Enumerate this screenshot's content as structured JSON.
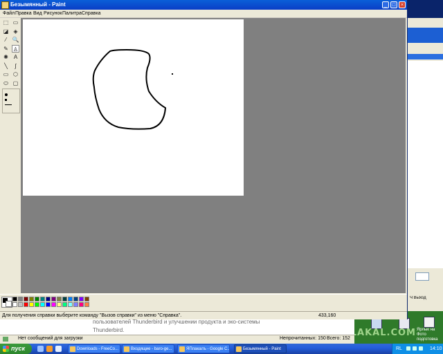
{
  "window": {
    "title": "Безымянный - Paint",
    "menu": [
      "Файл",
      "Правка",
      "Вид",
      "Рисунок",
      "Палитра",
      "Справка"
    ]
  },
  "toolbox": {
    "tools": [
      {
        "icon": "free-select-icon",
        "glyph": "⬚"
      },
      {
        "icon": "rect-select-icon",
        "glyph": "▭"
      },
      {
        "icon": "eraser-icon",
        "glyph": "◪"
      },
      {
        "icon": "fill-icon",
        "glyph": "◈"
      },
      {
        "icon": "color-picker-icon",
        "glyph": "⁄"
      },
      {
        "icon": "magnifier-icon",
        "glyph": "🔍"
      },
      {
        "icon": "pencil-icon",
        "glyph": "✎"
      },
      {
        "icon": "brush-icon",
        "glyph": "♙"
      },
      {
        "icon": "airbrush-icon",
        "glyph": "✺"
      },
      {
        "icon": "text-icon",
        "glyph": "A"
      },
      {
        "icon": "line-icon",
        "glyph": "╲"
      },
      {
        "icon": "curve-icon",
        "glyph": "∫"
      },
      {
        "icon": "rectangle-icon",
        "glyph": "▭"
      },
      {
        "icon": "polygon-icon",
        "glyph": "⬡"
      },
      {
        "icon": "ellipse-icon",
        "glyph": "⬭"
      },
      {
        "icon": "rounded-rect-icon",
        "glyph": "▢"
      }
    ],
    "selected_index": 7
  },
  "palette": {
    "foreground": "#000000",
    "background": "#ffffff",
    "colors_row1": [
      "#000000",
      "#808080",
      "#800000",
      "#808000",
      "#008000",
      "#008080",
      "#000080",
      "#800080",
      "#808040",
      "#004040",
      "#0080ff",
      "#004080",
      "#8000ff",
      "#804000"
    ],
    "colors_row2": [
      "#ffffff",
      "#c0c0c0",
      "#ff0000",
      "#ffff00",
      "#00ff00",
      "#00ffff",
      "#0000ff",
      "#ff00ff",
      "#ffff80",
      "#00ff80",
      "#80ffff",
      "#8080ff",
      "#ff0080",
      "#ff8040"
    ]
  },
  "status": {
    "help": "Для получения справки выберите команду \"Вызов справки\" из меню \"Справка\".",
    "coords": "433,160"
  },
  "browser": {
    "promo_line1": "пользователей Thunderbird и улучшении продукта и эко-системы",
    "promo_line2": "Thunderbird.",
    "status_text": "Нет сообщений для загрузки",
    "unread": "Непрочитанных: 150",
    "total": "Всего: 152"
  },
  "right_window": {
    "label": "Ч Выход"
  },
  "desktop": {
    "icon_label": "Ярлык на Фото подготовка",
    "watermark": "YAPLAKAL.COM"
  },
  "taskbar": {
    "start": "пуск",
    "tasks": [
      {
        "label": "Downloads - FreeCo...",
        "active": false
      },
      {
        "label": "Входящие - baro-ge...",
        "active": false
      },
      {
        "label": "ЯПлакалъ - Google C...",
        "active": false
      },
      {
        "label": "Безымянный - Paint",
        "active": true
      }
    ],
    "tray_lang": "RL",
    "clock": "14:10"
  }
}
